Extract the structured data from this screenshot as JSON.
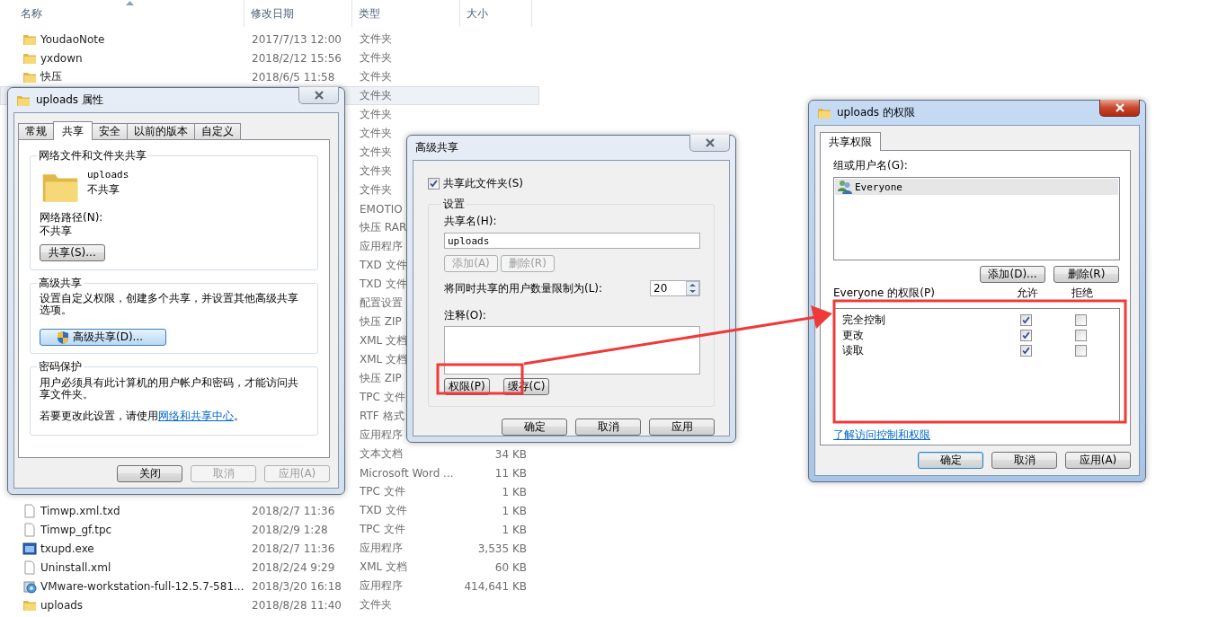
{
  "file_list": {
    "columns": [
      {
        "label": "名称",
        "sorted": true
      },
      {
        "label": "修改日期",
        "sorted": false
      },
      {
        "label": "类型",
        "sorted": false
      },
      {
        "label": "大小",
        "sorted": false
      }
    ],
    "rows": [
      {
        "kind": "folder",
        "name": "YoudaoNote",
        "date": "2017/7/13 12:00",
        "type": "文件夹",
        "selected": false
      },
      {
        "kind": "folder",
        "name": "yxdown",
        "date": "2018/2/12 15:56",
        "type": "文件夹",
        "selected": false
      },
      {
        "kind": "folder",
        "name": "快压",
        "date": "2018/6/5 11:58",
        "type": "文件夹",
        "selected": false
      },
      {
        "type": "文件夹",
        "selected": true
      },
      {
        "type": "文件夹",
        "selected": false
      },
      {
        "type": "文件夹",
        "selected": false
      },
      {
        "type": "文件夹",
        "selected": false
      },
      {
        "type": "文件夹",
        "selected": false
      },
      {
        "type": "文件夹",
        "selected": false
      },
      {
        "type": "EMOTIO",
        "selected": false
      },
      {
        "type": "快压 RAR",
        "selected": false
      },
      {
        "type": "应用程序",
        "selected": false
      },
      {
        "type": "TXD 文件",
        "selected": false
      },
      {
        "type": "TXD 文件",
        "selected": false
      },
      {
        "type": "配置设置",
        "selected": false
      },
      {
        "type": "快压 ZIP",
        "selected": false
      },
      {
        "type": "XML 文档",
        "selected": false
      },
      {
        "type": "XML 文档",
        "selected": false
      },
      {
        "type": "快压 ZIP",
        "selected": false
      },
      {
        "type": "TPC 文件",
        "selected": false
      },
      {
        "type": "RTF 格式",
        "selected": false
      },
      {
        "type": "应用程序",
        "selected": false
      },
      {
        "type": "文本文档",
        "size": "34 KB",
        "selected": false
      },
      {
        "type": "Microsoft Word ...",
        "size": "11 KB",
        "selected": false
      },
      {
        "type": "TPC 文件",
        "size": "1 KB",
        "selected": false
      },
      {
        "kind": "file",
        "name": "Timwp.xml.txd",
        "date": "2018/2/7 11:36",
        "type": "TXD 文件",
        "size": "1 KB",
        "selected": false
      },
      {
        "kind": "file",
        "name": "Timwp_gf.tpc",
        "date": "2018/2/9 1:28",
        "type": "TPC 文件",
        "size": "1 KB",
        "selected": false
      },
      {
        "kind": "exe",
        "name": "txupd.exe",
        "date": "2018/2/7 11:36",
        "type": "应用程序",
        "size": "3,535 KB",
        "selected": false
      },
      {
        "kind": "file",
        "name": "Uninstall.xml",
        "date": "2018/2/24 9:29",
        "type": "XML 文档",
        "size": "60 KB",
        "selected": false
      },
      {
        "kind": "setup",
        "name": "VMware-workstation-full-12.5.7-581...",
        "date": "2018/3/20 16:18",
        "type": "应用程序",
        "size": "414,641 KB",
        "selected": false
      },
      {
        "kind": "folder",
        "name": "uploads",
        "date": "2018/8/28 11:40",
        "type": "文件夹",
        "selected": false
      }
    ]
  },
  "properties_dialog": {
    "title": "uploads 属性",
    "active": false,
    "tabs": [
      {
        "label": "常规",
        "selected": false
      },
      {
        "label": "共享",
        "selected": true
      },
      {
        "label": "安全",
        "selected": false
      },
      {
        "label": "以前的版本",
        "selected": false
      },
      {
        "label": "自定义",
        "selected": false
      }
    ],
    "network_sharing": {
      "heading": "网络文件和文件夹共享",
      "folder_name": "uploads",
      "status": "不共享",
      "path_label": "网络路径(N):",
      "path": "不共享",
      "button": "共享(S)..."
    },
    "advanced": {
      "heading": "高级共享",
      "description": "设置自定义权限，创建多个共享，并设置其他高级共享选项。",
      "button": "高级共享(D)..."
    },
    "password": {
      "heading": "密码保护",
      "description": "用户必须具有此计算机的用户帐户和密码，才能访问共享文件夹。",
      "hint": "若要更改此设置，请使用",
      "link": "网络和共享中心",
      "hint_end": "。"
    },
    "buttons": [
      {
        "label": "关闭",
        "disabled": false
      },
      {
        "label": "取消",
        "disabled": true
      },
      {
        "label": "应用(A)",
        "disabled": true
      }
    ]
  },
  "advanced_sharing_dialog": {
    "title": "高级共享",
    "active": false,
    "share_checkbox": {
      "label": "共享此文件夹(S)",
      "checked": true
    },
    "settings": {
      "heading": "设置",
      "share_name_label": "共享名(H):",
      "share_name": "uploads",
      "name_buttons": [
        {
          "label": "添加(A)",
          "disabled": true
        },
        {
          "label": "删除(R)",
          "disabled": true
        }
      ],
      "limit_label": "将同时共享的用户数量限制为(L):",
      "limit": "20",
      "comment_label": "注释(O):",
      "action_buttons": [
        {
          "label": "权限(P)",
          "disabled": false
        },
        {
          "label": "缓存(C)",
          "disabled": false
        }
      ]
    },
    "buttons": [
      {
        "label": "确定",
        "disabled": false
      },
      {
        "label": "取消",
        "disabled": false
      },
      {
        "label": "应用",
        "disabled": false
      }
    ]
  },
  "permissions_dialog": {
    "title": "uploads 的权限",
    "active": true,
    "tabs": [
      {
        "label": "共享权限",
        "selected": true
      }
    ],
    "users_label": "组或用户名(G):",
    "users": [
      {
        "name": "Everyone",
        "selected": true
      }
    ],
    "user_buttons": [
      {
        "label": "添加(D)...",
        "disabled": false
      },
      {
        "label": "删除(R)",
        "disabled": false
      }
    ],
    "permissions_label": "Everyone 的权限(P)",
    "allow_label": "允许",
    "deny_label": "拒绝",
    "permissions": [
      {
        "name": "完全控制",
        "allow": true,
        "deny": false
      },
      {
        "name": "更改",
        "allow": true,
        "deny": false
      },
      {
        "name": "读取",
        "allow": true,
        "deny": false
      }
    ],
    "link": "了解访问控制和权限",
    "buttons": [
      {
        "label": "确定",
        "disabled": false,
        "default": true
      },
      {
        "label": "取消",
        "disabled": false,
        "default": false
      },
      {
        "label": "应用(A)",
        "disabled": false,
        "default": false
      }
    ]
  }
}
